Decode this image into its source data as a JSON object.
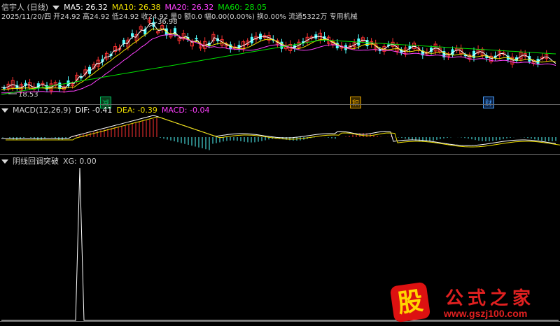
{
  "panel1": {
    "title": "信宇人 (日线)",
    "indicators": [
      {
        "label": "MA5: 26.32",
        "color": "#ffffff"
      },
      {
        "label": "MA10: 26.38",
        "color": "#f0e000"
      },
      {
        "label": "MA20: 26.32",
        "color": "#ff40ff"
      },
      {
        "label": "MA60: 28.05",
        "color": "#00e000"
      }
    ],
    "quote_line": "2025/11/20/四 开24.92 高24.92 低24.92 收24.92 量0 额0.0 幅0.00(0.00%) 换0.00% 流通5322万 专用机械",
    "high_mark": "36.98",
    "low_mark": "18.53",
    "tags": [
      {
        "text": "减",
        "color": "#00c060"
      },
      {
        "text": "积",
        "color": "#e0a000"
      },
      {
        "text": "财",
        "color": "#4aa0ff"
      }
    ]
  },
  "panel2": {
    "title": "MACD(12,26,9)",
    "dif": "DIF: -0.41",
    "dea": "DEA: -0.39",
    "macd": "MACD: -0.04"
  },
  "panel3": {
    "title": "阴线回调突破",
    "xg": "XG: 0.00"
  },
  "watermark": {
    "char": "股",
    "name": "公式之家",
    "url": "www.gszj100.com"
  },
  "colors": {
    "up": "#ff3232",
    "down": "#54ffff",
    "ma5": "#ffffff",
    "ma10": "#f0e000",
    "ma20": "#ff40ff",
    "ma60": "#00e000",
    "grid": "#6b6b6b"
  }
}
